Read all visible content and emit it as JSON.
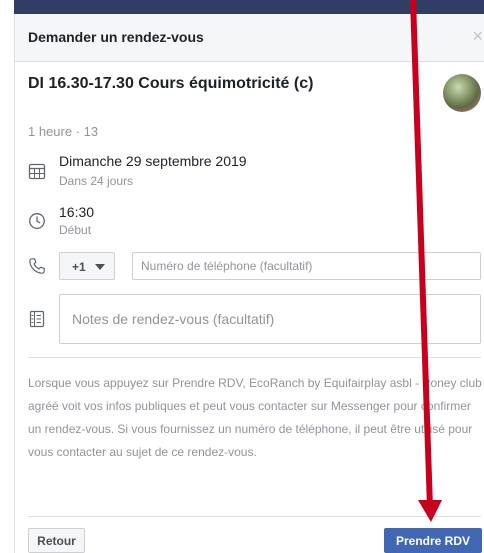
{
  "dialog": {
    "title": "Demander un rendez-vous",
    "close_glyph": "×"
  },
  "event": {
    "title": "DI 16.30-17.30 Cours équimotricité (c)",
    "meta": "1 heure · 13"
  },
  "date": {
    "main": "Dimanche 29 septembre 2019",
    "sub": "Dans 24 jours"
  },
  "time": {
    "main": "16:30",
    "sub": "Début"
  },
  "phone": {
    "country_code": "+1",
    "placeholder": "Numéro de téléphone (facultatif)"
  },
  "notes": {
    "placeholder": "Notes de rendez-vous (facultatif)"
  },
  "info_text": "Lorsque vous appuyez sur Prendre RDV, EcoRanch by Equifairplay asbl - Poney club agréé voit vos infos publiques et peut vous contacter sur Messenger pour confirmer un rendez-vous. Si vous fournissez un numéro de téléphone, il peut être utilisé pour vous contacter au sujet de ce rendez-vous.",
  "footer": {
    "back_label": "Retour",
    "primary_label": "Prendre RDV"
  },
  "icons": {
    "calendar": "calendar-icon",
    "clock": "clock-icon",
    "phone": "phone-icon",
    "notes": "notes-icon"
  },
  "colors": {
    "primary": "#4267b2",
    "header_bg": "#f5f6f7",
    "annotation_arrow": "#c8001e"
  }
}
